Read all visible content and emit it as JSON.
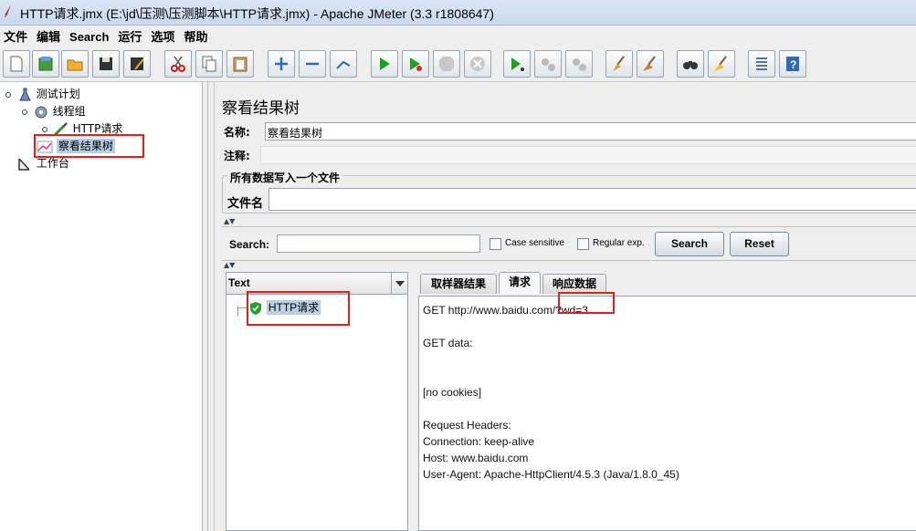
{
  "window": {
    "title": "HTTP请求.jmx (E:\\jd\\压测\\压测脚本\\HTTP请求.jmx) - Apache JMeter (3.3 r1808647)"
  },
  "menu": [
    "文件",
    "编辑",
    "Search",
    "运行",
    "选项",
    "帮助"
  ],
  "toolbar": [
    "new",
    "templates",
    "open",
    "save",
    "save-as",
    "cut",
    "copy",
    "paste",
    "expand",
    "collapse",
    "toggle",
    "start",
    "start-no-pause",
    "stop",
    "shutdown",
    "remote-start",
    "remote-stop",
    "remote-shutdown",
    "clear",
    "clear-all",
    "search",
    "reset-search",
    "function-helper",
    "help"
  ],
  "tree": {
    "test_plan": "测试计划",
    "thread_group": "线程组",
    "http_request": "HTTP请求",
    "result_tree": "察看结果树",
    "workbench": "工作台"
  },
  "panel": {
    "title": "察看结果树",
    "name_label": "名称:",
    "name_value": "察看结果树",
    "comment_label": "注释:",
    "comment_value": "",
    "file_group": "所有数据写入一个文件",
    "file_label": "文件名",
    "file_value": ""
  },
  "search": {
    "label": "Search:",
    "value": "",
    "case_sensitive": "Case sensitive",
    "regex": "Regular exp.",
    "search_btn": "Search",
    "reset_btn": "Reset"
  },
  "results": {
    "renderer": "Text",
    "items": [
      "HTTP请求"
    ],
    "tabs": [
      "取样器结果",
      "请求",
      "响应数据"
    ],
    "active_tab": "请求",
    "request_lines": [
      "GET http://www.baidu.com/?wd=3",
      "",
      "GET data:",
      "",
      "",
      "[no cookies]",
      "",
      "Request Headers:",
      "Connection: keep-alive",
      "Host: www.baidu.com",
      "User-Agent: Apache-HttpClient/4.5.3 (Java/1.8.0_45)"
    ]
  }
}
